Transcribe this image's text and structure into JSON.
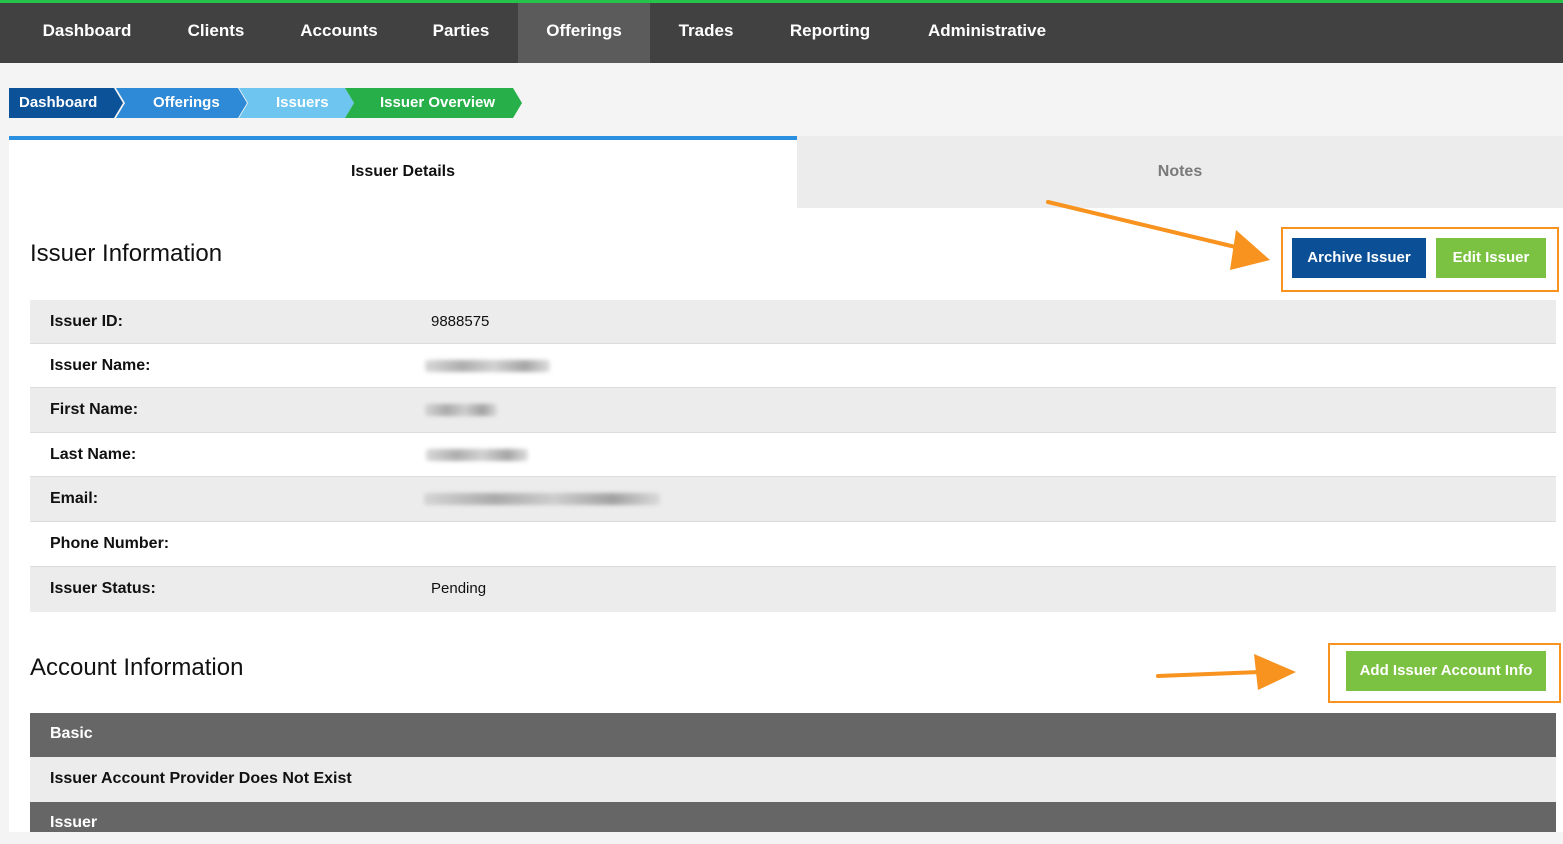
{
  "nav": {
    "items": [
      {
        "label": "Dashboard"
      },
      {
        "label": "Clients"
      },
      {
        "label": "Accounts"
      },
      {
        "label": "Parties"
      },
      {
        "label": "Offerings"
      },
      {
        "label": "Trades"
      },
      {
        "label": "Reporting"
      },
      {
        "label": "Administrative"
      }
    ],
    "active": "Offerings"
  },
  "breadcrumb": {
    "items": [
      {
        "label": "Dashboard",
        "color": "#0b5299"
      },
      {
        "label": "Offerings",
        "color": "#2e8ad6"
      },
      {
        "label": "Issuers",
        "color": "#6ec6f0"
      },
      {
        "label": "Issuer Overview",
        "color": "#27b049"
      }
    ]
  },
  "tabs": {
    "active": "Issuer Details",
    "inactive": "Notes"
  },
  "issuer_info": {
    "title": "Issuer Information",
    "archive_label": "Archive Issuer",
    "edit_label": "Edit Issuer",
    "rows": [
      {
        "label": "Issuer ID:",
        "value": "9888575"
      },
      {
        "label": "Issuer Name:",
        "value": ""
      },
      {
        "label": "First Name:",
        "value": ""
      },
      {
        "label": "Last Name:",
        "value": ""
      },
      {
        "label": "Email:",
        "value": ""
      },
      {
        "label": "Phone Number:",
        "value": ""
      },
      {
        "label": "Issuer Status:",
        "value": "Pending"
      }
    ]
  },
  "account_info": {
    "title": "Account Information",
    "add_label": "Add Issuer Account Info",
    "basic_header": "Basic",
    "provider_message": "Issuer Account Provider Does Not Exist",
    "issuer_header": "Issuer"
  },
  "colors": {
    "accent_orange": "#f7931e",
    "navy": "#0b4f96",
    "green": "#7cc242",
    "topbar_green": "#27c24c"
  }
}
